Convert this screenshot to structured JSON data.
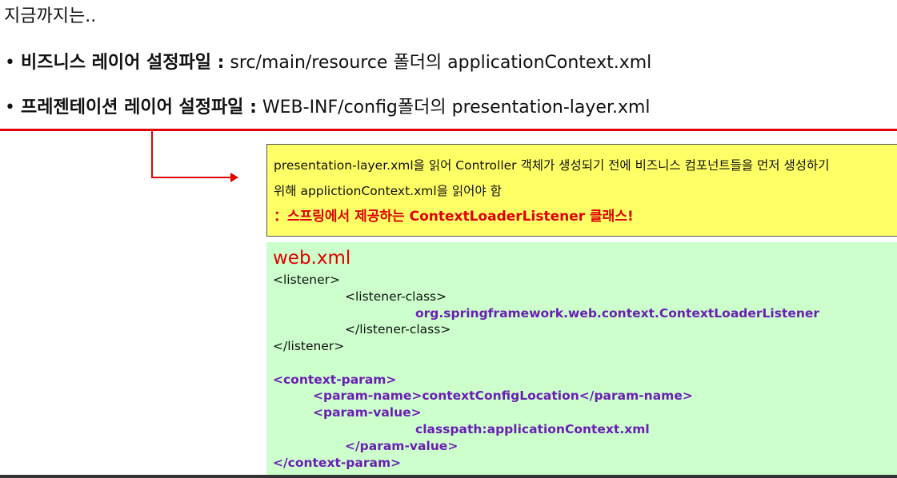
{
  "intro": "지금까지는..",
  "bullets": [
    {
      "marker": "•",
      "label": "비즈니스 레이어 설정파일 :",
      "text": " src/main/resource 폴더의 applicationContext.xml"
    },
    {
      "marker": "•",
      "label": "프레젠테이션 레이어 설정파일 :",
      "text": " WEB-INF/config폴더의 presentation-layer.xml"
    }
  ],
  "note": {
    "line1": "presentation-layer.xml을 읽어 Controller 객체가 생성되기 전에 비즈니스 컴포넌트들을 먼저 생성하기",
    "line2": "위해 applictionContext.xml을 읽어야 함",
    "line3": "：스프링에서 제공하는 ContextLoaderListener 클래스!"
  },
  "xml": {
    "title": "web.xml",
    "lines": [
      "<listener>",
      "<listener-class>",
      "org.springframework.web.context.ContextLoaderListener",
      "</listener-class>",
      "</listener>",
      "<context-param>",
      "<param-name>contextConfigLocation</param-name>",
      "<param-value>",
      "classpath:applicationContext.xml",
      "</param-value>",
      "</context-param>"
    ]
  },
  "colors": {
    "accent_red": "#e00000",
    "note_bg": "#ffff66",
    "code_bg": "#ccffcc",
    "purple": "#6a1fb3"
  }
}
